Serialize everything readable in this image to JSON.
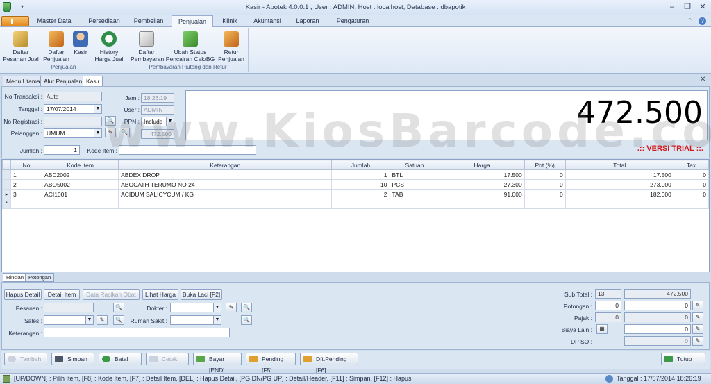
{
  "window": {
    "title": "Kasir - Apotek 4.0.0.1 , User : ADMIN, Host : localhost, Database : dbapotik"
  },
  "menu_tabs": [
    "Master Data",
    "Persediaan",
    "Pembelian",
    "Penjualan",
    "Klinik",
    "Akuntansi",
    "Laporan",
    "Pengaturan"
  ],
  "ribbon": {
    "group1": {
      "label": "Penjualan",
      "buttons": [
        "Daftar\nPesanan Jual",
        "Daftar\nPenjualan",
        "Kasir",
        "History\nHarga Jual"
      ]
    },
    "group2": {
      "label": "Pembayaran Piutang dan Retur",
      "buttons": [
        "Daftar\nPembayaran",
        "Ubah Status\nPencairan Cek/BG",
        "Retur\nPenjualan"
      ]
    }
  },
  "doc_tabs": [
    "Menu Utama",
    "Alur Penjualan",
    "Kasir"
  ],
  "form": {
    "no_transaksi_label": "No Transaksi :",
    "no_transaksi": "Auto",
    "tanggal_label": "Tanggal :",
    "tanggal": "17/07/2014",
    "no_registrasi_label": "No Registrasi :",
    "no_registrasi": "",
    "pelanggan_label": "Pelanggan :",
    "pelanggan": "UMUM",
    "jam_label": "Jam :",
    "jam": "18:26:19",
    "user_label": "User :",
    "user": "ADMIN",
    "ppn_label": "PPN :",
    "ppn": "Include",
    "pelanggan_amount": "472.500",
    "jumlah_label": "Jumlah :",
    "jumlah": "1",
    "kode_item_label": "Kode Item :",
    "kode_item": ""
  },
  "big_total": "472.500",
  "trial_label": ".:: VERSI TRIAL ::.",
  "watermark": "www.KiosBarcode.com",
  "grid": {
    "columns": [
      "No",
      "Kode Item",
      "Keterangan",
      "Jumlah",
      "Satuan",
      "Harga",
      "Pot (%)",
      "Total",
      "Tax"
    ],
    "rows": [
      {
        "no": "1",
        "kode": "ABD2002",
        "ket": "ABDEX DROP",
        "jumlah": "1",
        "satuan": "BTL",
        "harga": "17.500",
        "pot": "0",
        "total": "17.500",
        "tax": "0"
      },
      {
        "no": "2",
        "kode": "ABO5002",
        "ket": "ABOCATH TERUMO NO 24",
        "jumlah": "10",
        "satuan": "PCS",
        "harga": "27.300",
        "pot": "0",
        "total": "273.000",
        "tax": "0"
      },
      {
        "no": "3",
        "kode": "ACI1001",
        "ket": "ACIDUM SALICYCUM / KG",
        "jumlah": "2",
        "satuan": "TAB",
        "harga": "91.000",
        "pot": "0",
        "total": "182.000",
        "tax": "0"
      }
    ],
    "current_marker": "▸",
    "new_marker": "*"
  },
  "bottom_tabs": [
    "Rincian",
    "Potongan"
  ],
  "bottom": {
    "buttons": [
      "Hapus Detail",
      "Detail Item",
      "Data Racikan Obat",
      "Lihat Harga",
      "Buka Laci [F2]"
    ],
    "pesanan_label": "Pesanan :",
    "sales_label": "Sales :",
    "keterangan_label": "Keterangan :",
    "dokter_label": "Dokter :",
    "rumah_sakit_label": "Rumah Sakit :",
    "sub_total_label": "Sub Total :",
    "sub_total_count": "13",
    "sub_total": "472.500",
    "potongan_label": "Potongan :",
    "potongan_pct": "0",
    "potongan": "0",
    "pajak_label": "Pajak :",
    "pajak_pct": "0",
    "pajak": "0",
    "biaya_lain_label": "Biaya Lain :",
    "biaya_lain": "0",
    "dp_so_label": "DP SO :",
    "dp_so": "0"
  },
  "actions": [
    "Tambah",
    "Simpan",
    "Batal",
    "Cetak",
    "Bayar [END]",
    "Pending [F5]",
    "Dft.Pending [F6]",
    "Tutup"
  ],
  "statusbar": {
    "shortcuts": "[UP/DOWN] : Pilih Item, [F8] : Kode Item, [F7] : Detail Item, [DEL] : Hapus Detail, [PG DN/PG UP] : Detail/Header, [F11] : Simpan, [F12] : Hapus",
    "datetime": "Tanggal : 17/07/2014 18:26:19"
  },
  "colors": {
    "accent": "#e68a1c",
    "trial": "#d4191c",
    "frame": "#8da3c6"
  }
}
